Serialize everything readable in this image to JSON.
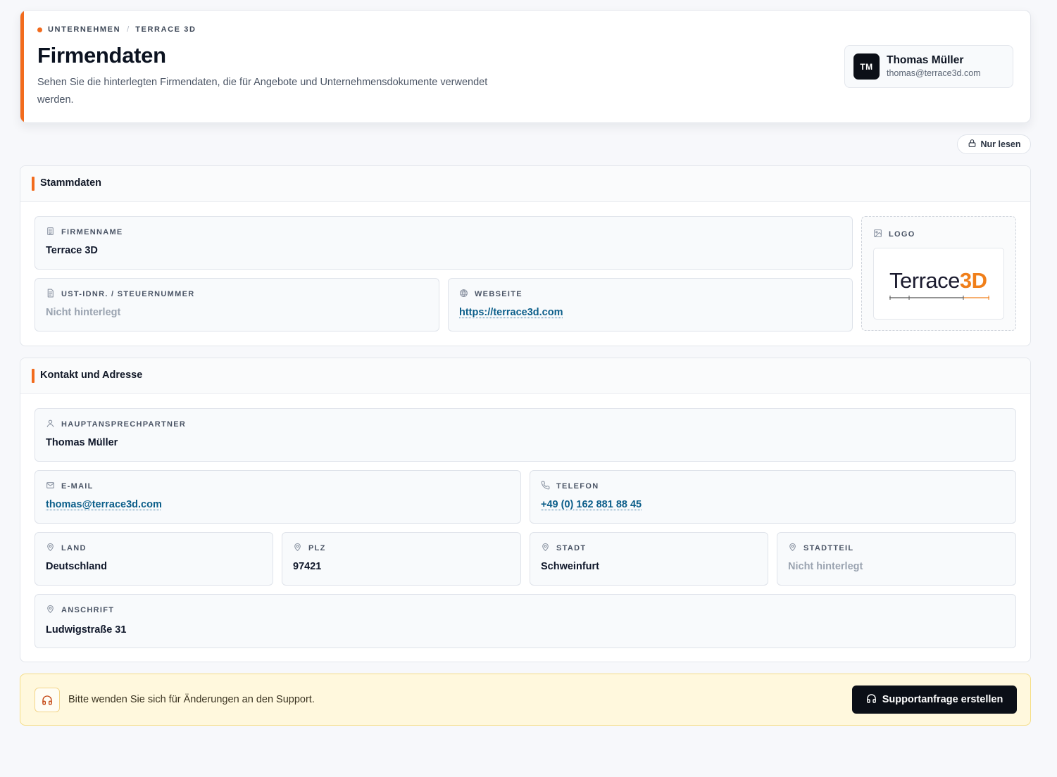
{
  "colors": {
    "accent": "#f26b1d",
    "primary_button": "#0b0f17",
    "link": "#0b5e8a",
    "support_bg": "#fff8dd"
  },
  "header": {
    "breadcrumb": [
      "UNTERNEHMEN",
      "TERRACE 3D"
    ],
    "breadcrumb_separator": "/",
    "title": "Firmendaten",
    "description": "Sehen Sie die hinterlegten Firmendaten, die für Angebote und Unternehmensdokumente verwendet werden.",
    "user": {
      "initials": "TM",
      "name": "Thomas Müller",
      "email": "thomas@terrace3d.com"
    }
  },
  "readonly_badge": {
    "label": "Nur lesen",
    "icon": "lock-icon"
  },
  "stammdaten": {
    "title": "Stammdaten",
    "firmenname": {
      "label": "FIRMENNAME",
      "value": "Terrace 3D",
      "icon": "building-icon"
    },
    "ust": {
      "label": "UST-IDNR. / STEUERNUMMER",
      "value": "Nicht hinterlegt",
      "icon": "document-icon"
    },
    "webseite": {
      "label": "WEBSEITE",
      "value": "https://terrace3d.com",
      "icon": "globe-icon"
    },
    "logo": {
      "label": "LOGO",
      "icon": "image-icon",
      "wordmark_dark": "Terrace",
      "wordmark_accent": "3D"
    }
  },
  "kontakt": {
    "title": "Kontakt und Adresse",
    "ansprechpartner": {
      "label": "HAUPTANSPRECHPARTNER",
      "value": "Thomas Müller",
      "icon": "user-icon"
    },
    "email": {
      "label": "E-MAIL",
      "value": "thomas@terrace3d.com",
      "icon": "mail-icon"
    },
    "telefon": {
      "label": "TELEFON",
      "value": "+49 (0) 162 881 88 45",
      "icon": "phone-icon"
    },
    "land": {
      "label": "LAND",
      "value": "Deutschland",
      "icon": "map-pin-icon"
    },
    "plz": {
      "label": "PLZ",
      "value": "97421",
      "icon": "map-pin-icon"
    },
    "stadt": {
      "label": "STADT",
      "value": "Schweinfurt",
      "icon": "map-pin-icon"
    },
    "stadtteil": {
      "label": "STADTTEIL",
      "value": "Nicht hinterlegt",
      "icon": "map-pin-icon"
    },
    "anschrift": {
      "label": "ANSCHRIFT",
      "value": "Ludwigstraße 31",
      "icon": "map-pin-icon"
    }
  },
  "support": {
    "message": "Bitte wenden Sie sich für Änderungen an den Support.",
    "button_label": "Supportanfrage erstellen",
    "icon": "headset-icon"
  }
}
